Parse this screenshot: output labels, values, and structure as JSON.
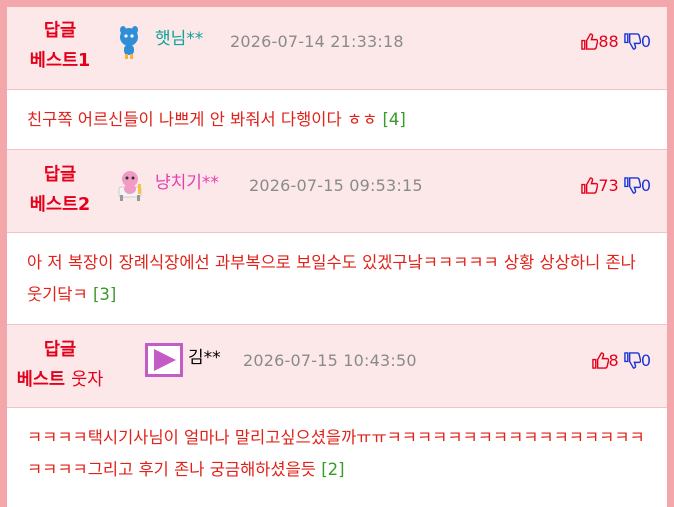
{
  "colors": {
    "frame": "#f3a7ab",
    "header_bg": "#fde8e9",
    "badge_text": "#e3001b",
    "body_text": "#e0221a",
    "date_text": "#8a8a8a",
    "upvote": "#e3001b",
    "downvote": "#1a35d6",
    "reply_count": "#3a9a2a"
  },
  "replies": [
    {
      "badge_top": "답글",
      "badge_rank": "베스트1",
      "badge_extra": "",
      "avatar_icon": "blue-cartoon-avatar-icon",
      "nickname": "햇님**",
      "nickname_color": "#11a39a",
      "date": "2026-07-14 21:33:18",
      "upvotes": "88",
      "downvotes": "0",
      "text": "친구쪽 어르신들이 나쁘게 안 봐줘서 다행이다 ㅎㅎ",
      "reply_count": "[4]"
    },
    {
      "badge_top": "답글",
      "badge_rank": "베스트2",
      "badge_extra": "",
      "avatar_icon": "pink-cartoon-avatar-icon",
      "nickname": "냥치기**",
      "nickname_color": "#e53fb0",
      "date": "2026-07-15 09:53:15",
      "upvotes": "73",
      "downvotes": "0",
      "text": "아 저 복장이 장례식장에선 과부복으로 보일수도 있겠구낰ㅋㅋㅋㅋㅋ 상황 상상하니 존나 웃기닼ㅋ",
      "reply_count": "[3]"
    },
    {
      "badge_top": "답글",
      "badge_rank": "베스트",
      "badge_extra": "웃자",
      "avatar_icon": "purple-play-avatar-icon",
      "nickname": "김**",
      "nickname_color": "#111111",
      "date": "2026-07-15 10:43:50",
      "upvotes": "8",
      "downvotes": "0",
      "text": "ㅋㅋㅋㅋ택시기사님이 얼마나 말리고싶으셨을까ㅠㅠㅋㅋㅋㅋㅋㅋㅋㅋㅋㅋㅋㅋㅋㅋㅋㅋㅋㅋㅋㅋㅋ그리고 후기 존나 궁금해하셨을듯",
      "reply_count": "[2]"
    }
  ]
}
